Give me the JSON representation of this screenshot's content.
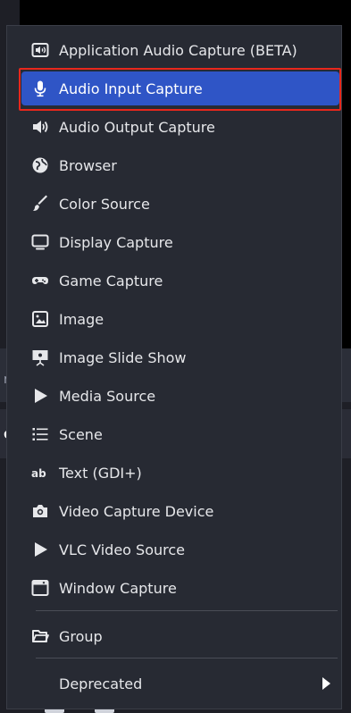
{
  "menu": {
    "items": [
      {
        "label": "Application Audio Capture (BETA)",
        "icon": "speaker-box-icon"
      },
      {
        "label": "Audio Input Capture",
        "icon": "microphone-icon",
        "selected": true
      },
      {
        "label": "Audio Output Capture",
        "icon": "speaker-icon"
      },
      {
        "label": "Browser",
        "icon": "globe-icon"
      },
      {
        "label": "Color Source",
        "icon": "paintbrush-icon"
      },
      {
        "label": "Display Capture",
        "icon": "monitor-icon"
      },
      {
        "label": "Game Capture",
        "icon": "gamepad-icon"
      },
      {
        "label": "Image",
        "icon": "image-icon"
      },
      {
        "label": "Image Slide Show",
        "icon": "slideshow-icon"
      },
      {
        "label": "Media Source",
        "icon": "play-icon"
      },
      {
        "label": "Scene",
        "icon": "list-icon"
      },
      {
        "label": "Text (GDI+)",
        "icon": "text-ab-icon"
      },
      {
        "label": "Video Capture Device",
        "icon": "camera-icon"
      },
      {
        "label": "VLC Video Source",
        "icon": "play-icon"
      },
      {
        "label": "Window Capture",
        "icon": "window-icon"
      }
    ],
    "group": {
      "label": "Group",
      "icon": "folder-icon"
    },
    "deprecated": {
      "label": "Deprecated",
      "icon": "chevron-right-icon"
    }
  },
  "background": {
    "fragment_left_1": "rs",
    "fragment_left_2": "o"
  },
  "colors": {
    "menu_bg": "#272a33",
    "selected_bg": "#2f55c6",
    "highlight_border": "#e8271c",
    "text": "#e6e7ea"
  }
}
